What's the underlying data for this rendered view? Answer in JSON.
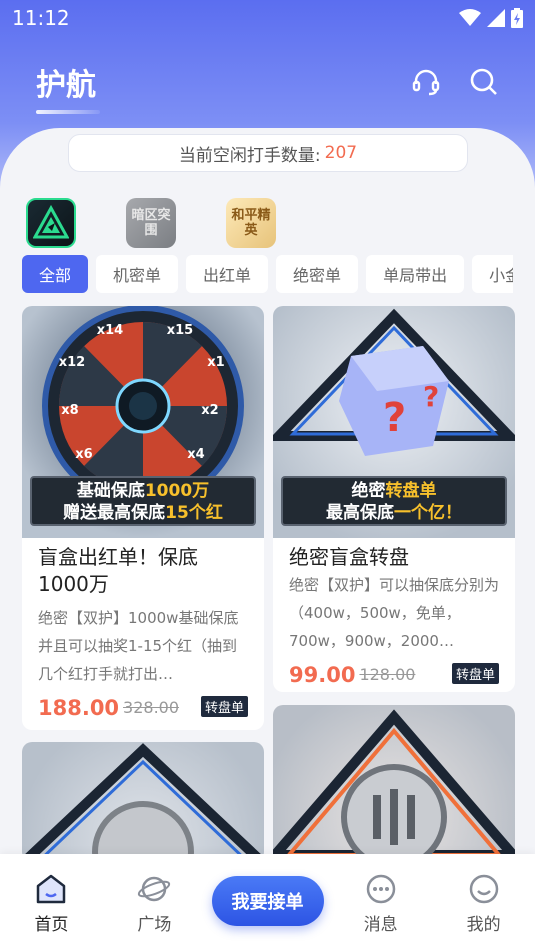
{
  "status_bar": {
    "time": "11:12"
  },
  "header": {
    "title": "护航"
  },
  "idle": {
    "label": "当前空闲打手数量:",
    "count": "207"
  },
  "games": [
    {
      "name": "game-triangle",
      "text": ""
    },
    {
      "name": "game-dark-zone",
      "text": "暗区突围"
    },
    {
      "name": "game-peace-elite",
      "text": "和平精英"
    }
  ],
  "tabs": [
    "全部",
    "机密单",
    "出红单",
    "绝密单",
    "单局带出",
    "小金"
  ],
  "cards": [
    {
      "title": "盲盒出红单！保底1000万",
      "desc": "绝密【双护】1000w基础保底并且可以抽奖1-15个红（抽到几个红打手就打出…",
      "price": "188.00",
      "old_price": "328.00",
      "tag": "转盘单",
      "banner_line1_a": "基础保底",
      "banner_line1_b": "1000万",
      "banner_line2_a": "赠送最高保底",
      "banner_line2_b": "15个红",
      "multipliers": [
        "x14",
        "x15",
        "x12",
        "x1",
        "x8",
        "x2",
        "x6",
        "x4"
      ]
    },
    {
      "title": "绝密盲盒转盘",
      "desc": "绝密【双护】可以抽保底分别为（400w，500w，免单，700w，900w，2000…",
      "price": "99.00",
      "old_price": "128.00",
      "tag": "转盘单",
      "banner_line1_a": "绝密",
      "banner_line1_b": "转盘单",
      "banner_line2_a": "最高保底",
      "banner_line2_b": "一个亿！"
    }
  ],
  "bottom_nav": {
    "home": "首页",
    "square": "广场",
    "cta": "我要接单",
    "messages": "消息",
    "mine": "我的"
  },
  "colors": {
    "accent": "#4e67f0",
    "price": "#f26b50"
  }
}
